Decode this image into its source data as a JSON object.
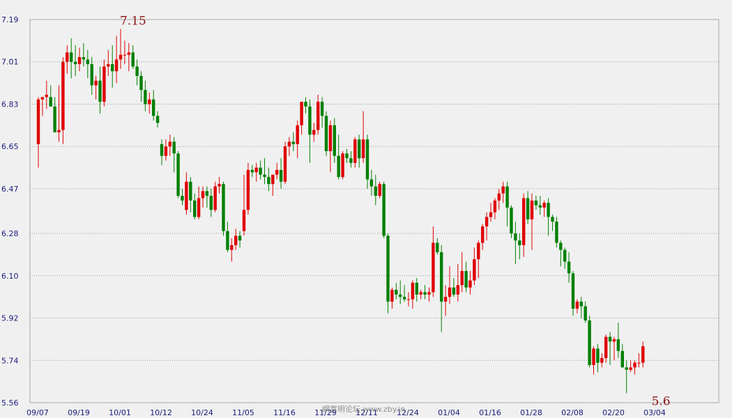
{
  "chart_data": {
    "type": "candlestick",
    "title": "",
    "xlabel": "",
    "ylabel": "",
    "ylim": [
      5.56,
      7.19
    ],
    "grid": true,
    "colors": {
      "up": "#e00000",
      "down": "#008000",
      "grid": "#9a9a9a",
      "axis_text": "#1a1a7a",
      "annotation": "#8b1414"
    },
    "y_ticks": [
      "7.19",
      "7.01",
      "6.83",
      "6.65",
      "6.47",
      "6.28",
      "6.10",
      "5.92",
      "5.74",
      "5.56"
    ],
    "x_ticks": [
      {
        "label": "09/07",
        "index": 0
      },
      {
        "label": "09/19",
        "index": 10
      },
      {
        "label": "10/01",
        "index": 20
      },
      {
        "label": "10/12",
        "index": 30
      },
      {
        "label": "10/24",
        "index": 40
      },
      {
        "label": "11/05",
        "index": 50
      },
      {
        "label": "11/16",
        "index": 60
      },
      {
        "label": "11/29",
        "index": 70
      },
      {
        "label": "12/11",
        "index": 80
      },
      {
        "label": "12/24",
        "index": 90
      },
      {
        "label": "01/04",
        "index": 100
      },
      {
        "label": "01/16",
        "index": 110
      },
      {
        "label": "01/28",
        "index": 120
      },
      {
        "label": "02/08",
        "index": 130
      },
      {
        "label": "02/20",
        "index": 140
      },
      {
        "label": "03/04",
        "index": 150
      }
    ],
    "annotations": [
      {
        "text": "7.15",
        "index": 21,
        "value": 7.15,
        "position": "above"
      },
      {
        "text": "5.6",
        "index": 149,
        "value": 5.6,
        "position": "below"
      }
    ],
    "watermark": "網富明论坛 www.zby.in",
    "candles": [
      [
        6.66,
        6.86,
        6.56,
        6.85
      ],
      [
        6.85,
        6.86,
        6.78,
        6.86
      ],
      [
        6.86,
        6.93,
        6.81,
        6.87
      ],
      [
        6.86,
        6.91,
        6.83,
        6.82
      ],
      [
        6.82,
        6.86,
        6.74,
        6.71
      ],
      [
        6.71,
        6.91,
        6.67,
        6.72
      ],
      [
        6.72,
        7.03,
        6.66,
        7.01
      ],
      [
        7.01,
        7.08,
        6.96,
        7.05
      ],
      [
        7.05,
        7.11,
        6.94,
        7.01
      ],
      [
        7.01,
        7.08,
        6.95,
        7.0
      ],
      [
        7.0,
        7.07,
        6.97,
        7.03
      ],
      [
        7.03,
        7.09,
        6.99,
        7.02
      ],
      [
        7.02,
        7.06,
        6.94,
        7.0
      ],
      [
        7.0,
        7.03,
        6.87,
        6.91
      ],
      [
        6.91,
        6.95,
        6.85,
        6.93
      ],
      [
        6.93,
        6.99,
        6.79,
        6.84
      ],
      [
        6.84,
        7.02,
        6.82,
        6.99
      ],
      [
        6.99,
        7.06,
        6.95,
        7.0
      ],
      [
        7.0,
        7.08,
        6.9,
        6.97
      ],
      [
        6.97,
        7.12,
        6.92,
        7.02
      ],
      [
        7.02,
        7.15,
        6.98,
        7.04
      ],
      [
        7.04,
        7.1,
        7.0,
        7.04
      ],
      [
        7.04,
        7.09,
        6.97,
        7.05
      ],
      [
        7.05,
        7.08,
        6.98,
        6.99
      ],
      [
        6.99,
        7.02,
        6.91,
        6.95
      ],
      [
        6.95,
        6.97,
        6.84,
        6.89
      ],
      [
        6.89,
        6.93,
        6.8,
        6.83
      ],
      [
        6.83,
        6.88,
        6.79,
        6.85
      ],
      [
        6.85,
        6.89,
        6.76,
        6.78
      ],
      [
        6.78,
        6.8,
        6.73,
        6.75
      ],
      [
        6.66,
        6.68,
        6.57,
        6.61
      ],
      [
        6.61,
        6.68,
        6.59,
        6.65
      ],
      [
        6.65,
        6.7,
        6.61,
        6.67
      ],
      [
        6.67,
        6.69,
        6.54,
        6.62
      ],
      [
        6.62,
        6.63,
        6.43,
        6.44
      ],
      [
        6.44,
        6.47,
        6.4,
        6.42
      ],
      [
        6.38,
        6.54,
        6.36,
        6.5
      ],
      [
        6.5,
        6.52,
        6.37,
        6.42
      ],
      [
        6.42,
        6.45,
        6.34,
        6.35
      ],
      [
        6.35,
        6.48,
        6.34,
        6.43
      ],
      [
        6.43,
        6.48,
        6.39,
        6.46
      ],
      [
        6.46,
        6.48,
        6.39,
        6.44
      ],
      [
        6.44,
        6.47,
        6.35,
        6.38
      ],
      [
        6.38,
        6.5,
        6.37,
        6.48
      ],
      [
        6.48,
        6.52,
        6.45,
        6.49
      ],
      [
        6.49,
        6.5,
        6.27,
        6.29
      ],
      [
        6.29,
        6.33,
        6.2,
        6.21
      ],
      [
        6.21,
        6.26,
        6.16,
        6.23
      ],
      [
        6.23,
        6.3,
        6.21,
        6.27
      ],
      [
        6.27,
        6.29,
        6.22,
        6.25
      ],
      [
        6.29,
        6.53,
        6.27,
        6.38
      ],
      [
        6.38,
        6.58,
        6.36,
        6.55
      ],
      [
        6.55,
        6.57,
        6.52,
        6.54
      ],
      [
        6.54,
        6.58,
        6.5,
        6.56
      ],
      [
        6.56,
        6.59,
        6.51,
        6.53
      ],
      [
        6.53,
        6.6,
        6.49,
        6.52
      ],
      [
        6.52,
        6.56,
        6.46,
        6.49
      ],
      [
        6.49,
        6.51,
        6.44,
        6.53
      ],
      [
        6.53,
        6.58,
        6.51,
        6.55
      ],
      [
        6.55,
        6.6,
        6.47,
        6.5
      ],
      [
        6.5,
        6.67,
        6.49,
        6.65
      ],
      [
        6.65,
        6.69,
        6.61,
        6.67
      ],
      [
        6.67,
        6.71,
        6.63,
        6.66
      ],
      [
        6.66,
        6.76,
        6.6,
        6.74
      ],
      [
        6.74,
        6.83,
        6.7,
        6.84
      ],
      [
        6.84,
        6.86,
        6.79,
        6.82
      ],
      [
        6.82,
        6.85,
        6.58,
        6.7
      ],
      [
        6.7,
        6.75,
        6.67,
        6.72
      ],
      [
        6.72,
        6.87,
        6.7,
        6.84
      ],
      [
        6.84,
        6.86,
        6.73,
        6.78
      ],
      [
        6.78,
        6.8,
        6.61,
        6.63
      ],
      [
        6.63,
        6.76,
        6.54,
        6.74
      ],
      [
        6.74,
        6.77,
        6.58,
        6.61
      ],
      [
        6.61,
        6.7,
        6.51,
        6.52
      ],
      [
        6.52,
        6.63,
        6.51,
        6.62
      ],
      [
        6.62,
        6.64,
        6.58,
        6.6
      ],
      [
        6.6,
        6.63,
        6.56,
        6.58
      ],
      [
        6.58,
        6.69,
        6.56,
        6.68
      ],
      [
        6.68,
        6.7,
        6.56,
        6.6
      ],
      [
        6.6,
        6.8,
        6.58,
        6.68
      ],
      [
        6.68,
        6.7,
        6.47,
        6.51
      ],
      [
        6.51,
        6.55,
        6.44,
        6.48
      ],
      [
        6.48,
        6.53,
        6.4,
        6.44
      ],
      [
        6.44,
        6.5,
        6.43,
        6.49
      ],
      [
        6.49,
        6.5,
        6.26,
        6.27
      ],
      [
        6.27,
        6.28,
        5.94,
        5.99
      ],
      [
        5.99,
        6.05,
        5.96,
        6.04
      ],
      [
        6.04,
        6.07,
        6.0,
        6.02
      ],
      [
        6.02,
        6.08,
        5.98,
        6.01
      ],
      [
        6.01,
        6.06,
        5.99,
        6.0
      ],
      [
        6.0,
        6.03,
        5.97,
        6.0
      ],
      [
        6.0,
        6.08,
        5.96,
        6.07
      ],
      [
        6.07,
        6.09,
        5.99,
        6.02
      ],
      [
        6.02,
        6.04,
        6.0,
        6.03
      ],
      [
        6.03,
        6.06,
        6.0,
        6.02
      ],
      [
        6.02,
        6.05,
        5.99,
        6.03
      ],
      [
        6.03,
        6.31,
        6.01,
        6.24
      ],
      [
        6.24,
        6.26,
        6.19,
        6.2
      ],
      [
        6.2,
        6.23,
        5.86,
        5.99
      ],
      [
        5.99,
        6.06,
        5.93,
        6.01
      ],
      [
        6.01,
        6.14,
        5.98,
        6.05
      ],
      [
        6.05,
        6.09,
        6.01,
        6.02
      ],
      [
        6.02,
        6.15,
        5.99,
        6.06
      ],
      [
        6.06,
        6.2,
        6.03,
        6.12
      ],
      [
        6.12,
        6.16,
        6.03,
        6.05
      ],
      [
        6.05,
        6.12,
        6.02,
        6.08
      ],
      [
        6.08,
        6.22,
        6.06,
        6.17
      ],
      [
        6.17,
        6.25,
        6.09,
        6.24
      ],
      [
        6.24,
        6.32,
        6.21,
        6.31
      ],
      [
        6.31,
        6.37,
        6.25,
        6.35
      ],
      [
        6.35,
        6.41,
        6.33,
        6.37
      ],
      [
        6.37,
        6.43,
        6.34,
        6.42
      ],
      [
        6.42,
        6.47,
        6.38,
        6.45
      ],
      [
        6.45,
        6.5,
        6.41,
        6.48
      ],
      [
        6.48,
        6.5,
        6.31,
        6.39
      ],
      [
        6.39,
        6.4,
        6.26,
        6.28
      ],
      [
        6.28,
        6.33,
        6.15,
        6.25
      ],
      [
        6.25,
        6.28,
        6.17,
        6.23
      ],
      [
        6.23,
        6.45,
        6.18,
        6.43
      ],
      [
        6.43,
        6.46,
        6.32,
        6.34
      ],
      [
        6.34,
        6.45,
        6.21,
        6.42
      ],
      [
        6.42,
        6.44,
        6.38,
        6.4
      ],
      [
        6.4,
        6.44,
        6.36,
        6.39
      ],
      [
        6.39,
        6.42,
        6.35,
        6.41
      ],
      [
        6.41,
        6.43,
        6.27,
        6.35
      ],
      [
        6.35,
        6.36,
        6.29,
        6.33
      ],
      [
        6.33,
        6.35,
        6.22,
        6.24
      ],
      [
        6.24,
        6.25,
        6.14,
        6.21
      ],
      [
        6.21,
        6.22,
        6.13,
        6.16
      ],
      [
        6.16,
        6.2,
        6.07,
        6.11
      ],
      [
        6.11,
        6.12,
        5.93,
        5.96
      ],
      [
        5.96,
        6.0,
        5.94,
        5.99
      ],
      [
        5.99,
        6.01,
        5.92,
        5.97
      ],
      [
        5.97,
        5.99,
        5.9,
        5.91
      ],
      [
        5.91,
        5.93,
        5.71,
        5.72
      ],
      [
        5.72,
        5.8,
        5.68,
        5.79
      ],
      [
        5.79,
        5.81,
        5.69,
        5.73
      ],
      [
        5.73,
        5.77,
        5.71,
        5.75
      ],
      [
        5.75,
        5.85,
        5.73,
        5.84
      ],
      [
        5.84,
        5.86,
        5.72,
        5.82
      ],
      [
        5.82,
        5.84,
        5.74,
        5.83
      ],
      [
        5.83,
        5.9,
        5.75,
        5.78
      ],
      [
        5.78,
        5.81,
        5.71,
        5.71
      ],
      [
        5.71,
        5.74,
        5.6,
        5.7
      ],
      [
        5.7,
        5.74,
        5.69,
        5.71
      ],
      [
        5.71,
        5.74,
        5.68,
        5.73
      ],
      [
        5.73,
        5.77,
        5.71,
        5.73
      ],
      [
        5.73,
        5.82,
        5.71,
        5.8
      ]
    ]
  }
}
